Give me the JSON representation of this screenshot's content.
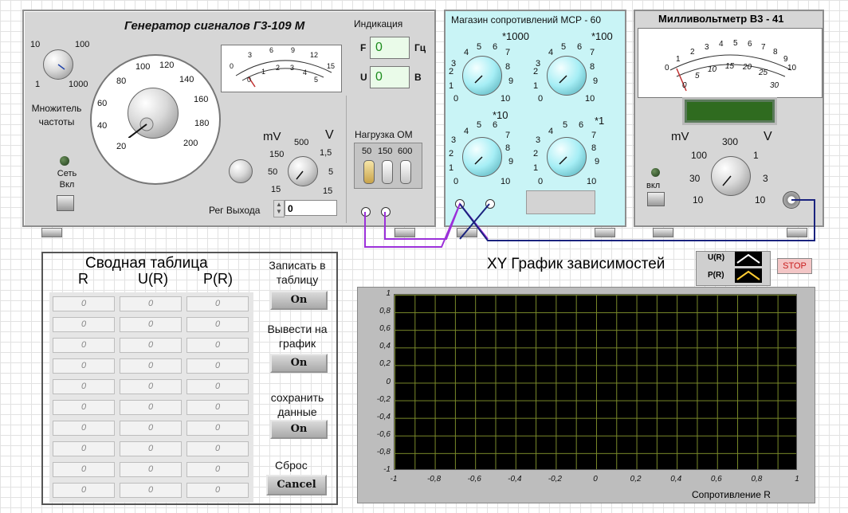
{
  "generator": {
    "title": "Генератор сигналов Г3-109 М",
    "indication_label": "Индикация",
    "f_label": "F",
    "f_value": "0",
    "f_unit": "Гц",
    "u_label": "U",
    "u_value": "0",
    "u_unit": "В",
    "multiplier_label": "Множитель частоты",
    "multiplier_scale": [
      "10",
      "100",
      "1",
      "1000"
    ],
    "freq_scale": [
      "20",
      "40",
      "60",
      "80",
      "100",
      "120",
      "140",
      "160",
      "180",
      "200"
    ],
    "meter_scale_top": [
      "0",
      "3",
      "6",
      "9",
      "12",
      "15"
    ],
    "meter_scale_bottom": [
      "0",
      "1",
      "2",
      "3",
      "4",
      "5"
    ],
    "net_label": "Сеть Вкл",
    "mv_label": "mV",
    "v_label": "V",
    "range_scale_left": [
      "150",
      "50",
      "15"
    ],
    "range_scale_mid": [
      "500"
    ],
    "range_scale_right": [
      "1,5",
      "5",
      "15"
    ],
    "load_label": "Нагрузка ОМ",
    "load_values": [
      "50",
      "150",
      "600"
    ],
    "output_label": "Рег Выхода",
    "output_value": "0"
  },
  "msr": {
    "title": "Магазин сопротивлений МСР - 60",
    "decade_labels": [
      "*1000",
      "*100",
      "*10",
      "*1"
    ],
    "dial_numbers": [
      "4",
      "5",
      "6",
      "7",
      "3",
      "8",
      "2",
      "9",
      "1",
      "0",
      "10"
    ]
  },
  "millivoltmeter": {
    "title": "Милливольтметр В3 - 41",
    "scale_top": [
      "0",
      "1",
      "2",
      "3",
      "4",
      "5",
      "6",
      "7",
      "8",
      "9",
      "10"
    ],
    "scale_bottom": [
      "0",
      "5",
      "10",
      "15",
      "20",
      "25",
      "30"
    ],
    "mv_label": "mV",
    "v_label": "V",
    "range_scale": [
      "100",
      "300",
      "1",
      "30",
      "3",
      "10",
      "10"
    ],
    "power_label": "вкл"
  },
  "table": {
    "title": "Сводная таблица",
    "headers": [
      "R",
      "U(R)",
      "P(R)"
    ],
    "rows": [
      [
        "0",
        "0",
        "0"
      ],
      [
        "0",
        "0",
        "0"
      ],
      [
        "0",
        "0",
        "0"
      ],
      [
        "0",
        "0",
        "0"
      ],
      [
        "0",
        "0",
        "0"
      ],
      [
        "0",
        "0",
        "0"
      ],
      [
        "0",
        "0",
        "0"
      ],
      [
        "0",
        "0",
        "0"
      ],
      [
        "0",
        "0",
        "0"
      ],
      [
        "0",
        "0",
        "0"
      ]
    ]
  },
  "controls": {
    "write_label": "Записать в таблицу",
    "write_button": "On",
    "plot_label": "Вывести на график",
    "plot_button": "On",
    "save_label": "сохранить данные",
    "save_button": "On",
    "reset_label": "Сброс",
    "reset_button": "Cancel"
  },
  "graph": {
    "title": "XY График зависимостей",
    "legend": [
      "U(R)",
      "P(R)"
    ],
    "stop_label": "STOP",
    "xlabel": "Сопротивление R",
    "y_ticks": [
      "1",
      "0,8",
      "0,6",
      "0,4",
      "0,2",
      "0",
      "-0,2",
      "-0,4",
      "-0,6",
      "-0,8",
      "-1"
    ],
    "x_ticks": [
      "-1",
      "-0,8",
      "-0,6",
      "-0,4",
      "-0,2",
      "0",
      "0,2",
      "0,4",
      "0,6",
      "0,8",
      "1"
    ],
    "colors": {
      "u_series": "#ffffff",
      "p_series": "#ffcc33",
      "grid": "#7a8a2a"
    }
  },
  "wires": {
    "purple": "#9b30d9",
    "navy": "#1a237e"
  }
}
